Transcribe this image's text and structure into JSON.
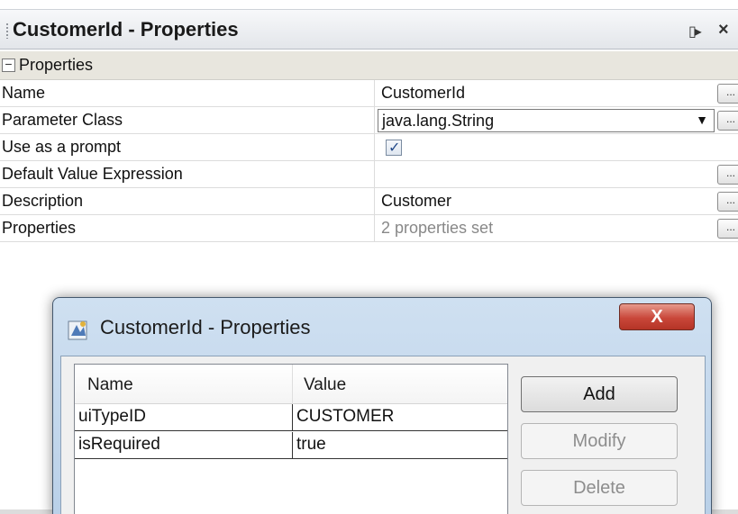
{
  "panel": {
    "title": "CustomerId - Properties",
    "dock_glyph": "▯▸",
    "close_glyph": "×"
  },
  "category": {
    "toggle": "−",
    "label": "Properties"
  },
  "rows": [
    {
      "name": "Name",
      "value": "CustomerId",
      "button": "..."
    },
    {
      "name": "Parameter Class",
      "value": "java.lang.String",
      "button": "..."
    },
    {
      "name": "Use as a prompt",
      "value": "",
      "checked": true
    },
    {
      "name": "Default Value Expression",
      "value": "",
      "button": "..."
    },
    {
      "name": "Description",
      "value": "Customer",
      "button": "..."
    },
    {
      "name": "Properties",
      "value": "2 properties set",
      "button": "..."
    }
  ],
  "dialog": {
    "title": "CustomerId - Properties",
    "close_glyph": "X",
    "columns": {
      "name": "Name",
      "value": "Value"
    },
    "items": [
      {
        "name": "uiTypeID",
        "value": "CUSTOMER"
      },
      {
        "name": "isRequired",
        "value": "true"
      }
    ],
    "buttons": {
      "add": "Add",
      "modify": "Modify",
      "delete": "Delete"
    }
  },
  "colors": {
    "accent_close": "#c9473a",
    "dialog_frame": "#b9d0e8"
  }
}
